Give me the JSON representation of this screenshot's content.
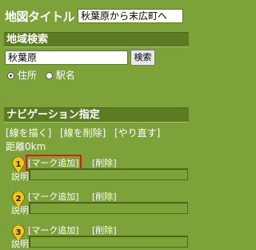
{
  "title": {
    "label": "地図タイトル",
    "value": "秋葉原から末広町へ"
  },
  "area_search": {
    "header": "地域検索",
    "query": "秋葉原",
    "search_button": "検索",
    "options": [
      {
        "label": "住所",
        "checked": true
      },
      {
        "label": "駅名",
        "checked": false
      }
    ]
  },
  "navigation": {
    "header": "ナビゲーション指定",
    "draw_line": "[線を描く]",
    "delete_line": "[線を削除]",
    "redo": "[やり直す]",
    "distance": "距離0km",
    "markers": [
      {
        "number": "1",
        "add": "[マーク追加]",
        "delete": "[削除]",
        "desc_label": "説明",
        "desc_value": ""
      },
      {
        "number": "2",
        "add": "[マーク追加]",
        "delete": "[削除]",
        "desc_label": "説明",
        "desc_value": ""
      },
      {
        "number": "3",
        "add": "[マーク追加]",
        "delete": "[削除]",
        "desc_label": "説明",
        "desc_value": ""
      }
    ],
    "marker_color": "#f2c818",
    "highlight_color": "#d71e1e"
  }
}
